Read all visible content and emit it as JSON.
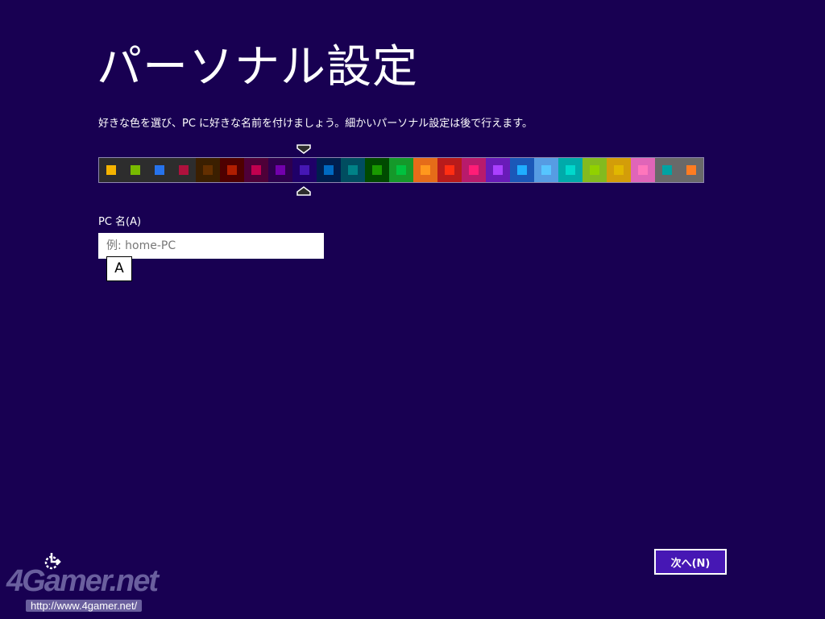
{
  "title": "パーソナル設定",
  "description": "好きな色を選び、PC に好きな名前を付けましょう。細かいパーソナル設定は後で行えます。",
  "color_picker": {
    "selected_index": 8,
    "tiles": [
      {
        "bg": "#2d2d2d",
        "fg": "#f4b300"
      },
      {
        "bg": "#2d2d2d",
        "fg": "#78ba00"
      },
      {
        "bg": "#2d2d2d",
        "fg": "#2673ec"
      },
      {
        "bg": "#2d2d2d",
        "fg": "#ae113d"
      },
      {
        "bg": "#3b1f00",
        "fg": "#632f00"
      },
      {
        "bg": "#4e0000",
        "fg": "#b01e00"
      },
      {
        "bg": "#4e0038",
        "fg": "#c1004f"
      },
      {
        "bg": "#2d004e",
        "fg": "#7200ac"
      },
      {
        "bg": "#1f0068",
        "fg": "#4617b4"
      },
      {
        "bg": "#001e4e",
        "fg": "#006ac1"
      },
      {
        "bg": "#004d60",
        "fg": "#008287"
      },
      {
        "bg": "#004a00",
        "fg": "#199900"
      },
      {
        "bg": "#15992a",
        "fg": "#00c13f"
      },
      {
        "bg": "#e56c19",
        "fg": "#ff981d"
      },
      {
        "bg": "#b81b1b",
        "fg": "#ff2e12"
      },
      {
        "bg": "#b81b6c",
        "fg": "#ff1d77"
      },
      {
        "bg": "#691bb8",
        "fg": "#aa40ff"
      },
      {
        "bg": "#1b58b8",
        "fg": "#1faeff"
      },
      {
        "bg": "#569ce3",
        "fg": "#56c5ff"
      },
      {
        "bg": "#00aaaa",
        "fg": "#00d8cc"
      },
      {
        "bg": "#83ba1f",
        "fg": "#91d100"
      },
      {
        "bg": "#d39d09",
        "fg": "#e1b700"
      },
      {
        "bg": "#e065b8",
        "fg": "#ff76bc"
      },
      {
        "bg": "#696969",
        "fg": "#00a3a3"
      },
      {
        "bg": "#696969",
        "fg": "#fe7c22"
      }
    ]
  },
  "pc_name": {
    "label": "PC 名(A)",
    "placeholder": "例: home-PC",
    "value": ""
  },
  "ime_indicator": "A",
  "next_button": "次へ(N)",
  "watermark": {
    "logo": "4Gamer.net",
    "url": "http://www.4gamer.net/"
  }
}
